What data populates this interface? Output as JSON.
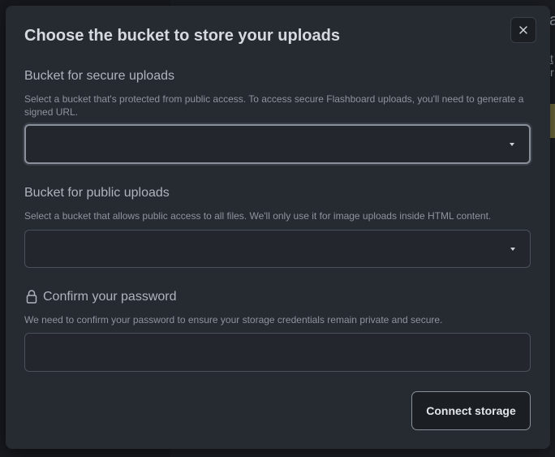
{
  "background": {
    "peek_title_char": "a",
    "peek_link_char": "t",
    "peek_char_2": "r"
  },
  "modal": {
    "title": "Choose the bucket to store your uploads",
    "close_icon": "close-icon"
  },
  "secure_bucket": {
    "label": "Bucket for secure uploads",
    "help": "Select a bucket that's protected from public access. To access secure Flashboard uploads, you'll need to generate a signed URL.",
    "selected_value": ""
  },
  "public_bucket": {
    "label": "Bucket for public uploads",
    "help": "Select a bucket that allows public access to all files. We'll only use it for image uploads inside HTML content.",
    "selected_value": ""
  },
  "password": {
    "label": "Confirm your password",
    "icon": "lock-icon",
    "help": "We need to confirm your password to ensure your storage credentials remain private and secure.",
    "value": ""
  },
  "actions": {
    "connect_label": "Connect storage"
  },
  "colors": {
    "modal_bg": "#262a31",
    "page_bg": "#16191d",
    "title": "#d6dae0",
    "help_text": "#8e949d"
  }
}
